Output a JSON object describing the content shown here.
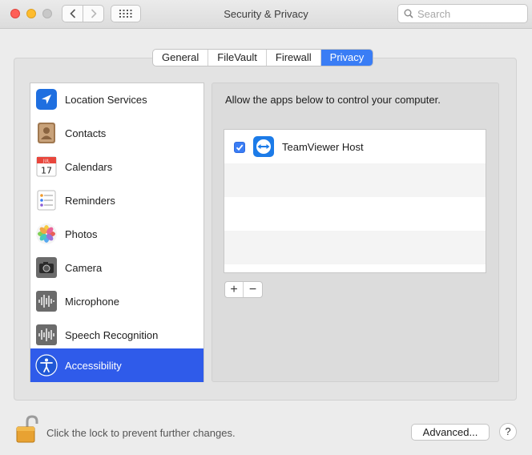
{
  "window": {
    "title": "Security & Privacy"
  },
  "search": {
    "placeholder": "Search"
  },
  "tabs": [
    {
      "label": "General",
      "active": false
    },
    {
      "label": "FileVault",
      "active": false
    },
    {
      "label": "Firewall",
      "active": false
    },
    {
      "label": "Privacy",
      "active": true
    }
  ],
  "sidebar": {
    "items": [
      {
        "label": "Location Services",
        "icon": "location-arrow-icon"
      },
      {
        "label": "Contacts",
        "icon": "contacts-icon"
      },
      {
        "label": "Calendars",
        "icon": "calendar-icon",
        "icon_month": "JUL",
        "icon_day": "17"
      },
      {
        "label": "Reminders",
        "icon": "reminders-icon"
      },
      {
        "label": "Photos",
        "icon": "photos-icon"
      },
      {
        "label": "Camera",
        "icon": "camera-icon"
      },
      {
        "label": "Microphone",
        "icon": "microphone-waveform-icon"
      },
      {
        "label": "Speech Recognition",
        "icon": "speech-waveform-icon"
      },
      {
        "label": "Accessibility",
        "icon": "accessibility-icon",
        "selected": true
      }
    ]
  },
  "main": {
    "description": "Allow the apps below to control your computer.",
    "apps": [
      {
        "name": "TeamViewer Host",
        "checked": true,
        "icon": "teamviewer-icon"
      }
    ],
    "add_label": "+",
    "remove_label": "−"
  },
  "footer": {
    "lock_text": "Click the lock to prevent further changes.",
    "advanced_label": "Advanced...",
    "help_label": "?"
  },
  "colors": {
    "accent": "#3a7df5",
    "selection": "#2f5bea",
    "window_bg": "#ececec"
  }
}
